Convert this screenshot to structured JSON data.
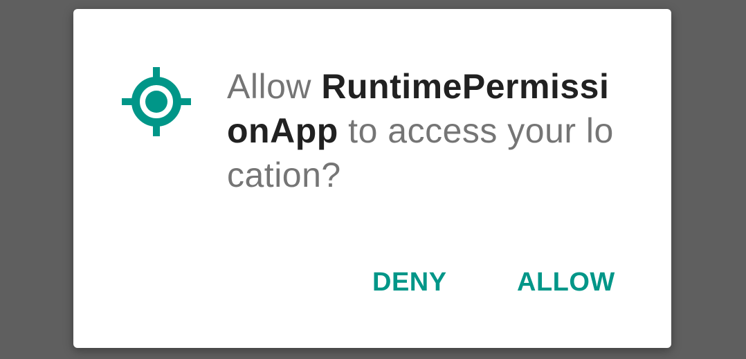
{
  "dialog": {
    "message_prefix": "Allow ",
    "app_name": "RuntimePermissionApp",
    "message_suffix": " to access your location?",
    "icon": "location-target-icon",
    "deny_label": "DENY",
    "allow_label": "ALLOW"
  },
  "colors": {
    "accent": "#009688",
    "scrim": "#5f5f5f",
    "dialog_bg": "#ffffff",
    "text_primary": "#212121",
    "text_secondary": "#757575"
  }
}
